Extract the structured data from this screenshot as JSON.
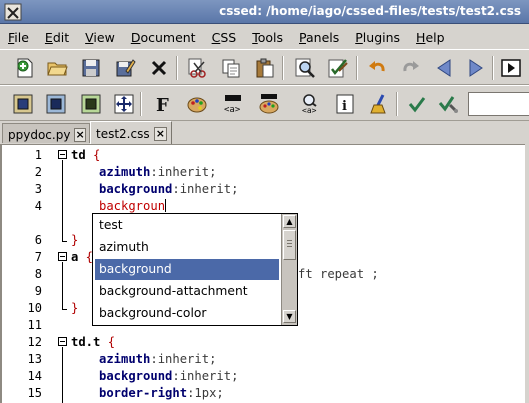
{
  "window": {
    "title": "cssed: /home/iago/cssed-files/tests/test2.css"
  },
  "menu": [
    {
      "label": "File",
      "mnemonic": "F",
      "rest": "ile"
    },
    {
      "label": "Edit",
      "mnemonic": "E",
      "rest": "dit"
    },
    {
      "label": "View",
      "mnemonic": "V",
      "rest": "iew"
    },
    {
      "label": "Document",
      "mnemonic": "D",
      "rest": "ocument"
    },
    {
      "label": "CSS",
      "mnemonic": "C",
      "rest": "SS"
    },
    {
      "label": "Tools",
      "mnemonic": "T",
      "rest": "ools"
    },
    {
      "label": "Panels",
      "mnemonic": "P",
      "rest": "anels"
    },
    {
      "label": "Plugins",
      "mnemonic": "P",
      "rest": "lugins"
    },
    {
      "label": "Help",
      "mnemonic": "H",
      "rest": "elp"
    }
  ],
  "toolbar1": [
    "new-file-icon",
    "open-folder-icon",
    "save-icon",
    "save-as-icon",
    "close-icon",
    "cut-icon",
    "copy-icon",
    "paste-icon",
    "search-icon",
    "replace-icon",
    "undo-icon",
    "redo-icon",
    "previous-icon",
    "next-icon",
    "play-icon"
  ],
  "toolbar2": [
    "border-box-icon",
    "border-box-icon",
    "border-box-icon",
    "move-icon",
    "font-icon",
    "color-palette-icon",
    "tag-a-icon",
    "color-palette-icon",
    "search-tag-icon",
    "info-icon",
    "broom-icon",
    "check-icon",
    "validate-icon"
  ],
  "tabs": [
    {
      "label": "ppydoc.py",
      "close": "×",
      "active": false
    },
    {
      "label": "test2.css",
      "close": "×",
      "active": true
    }
  ],
  "editor": {
    "line_numbers": [
      "1",
      "2",
      "3",
      "4",
      "5",
      "6",
      "7",
      "8",
      "9",
      "10",
      "11",
      "12",
      "13",
      "14",
      "15"
    ],
    "line1": {
      "selector": "td",
      "brace": " {"
    },
    "line2": {
      "prop": "azimuth",
      "val": ":inherit;"
    },
    "line3": {
      "prop": "background",
      "val": ":inherit;"
    },
    "line4": {
      "typed": "backgroun"
    },
    "line6": {
      "brace": "}"
    },
    "line7": {
      "selector": "a",
      "brace": " {"
    },
    "line8": {
      "val": "ft repeat ;"
    },
    "line10": {
      "brace": "}"
    },
    "line12": {
      "selector": "td.t",
      "brace": " {"
    },
    "line13": {
      "prop": "azimuth",
      "val": ":inherit;"
    },
    "line14": {
      "prop": "background",
      "val": ":inherit;"
    },
    "line15": {
      "prop": "border-right",
      "val": ":1px;"
    }
  },
  "autocomplete": {
    "items": [
      "test",
      "azimuth",
      "background",
      "background-attachment",
      "background-color"
    ],
    "selected_index": 2
  }
}
